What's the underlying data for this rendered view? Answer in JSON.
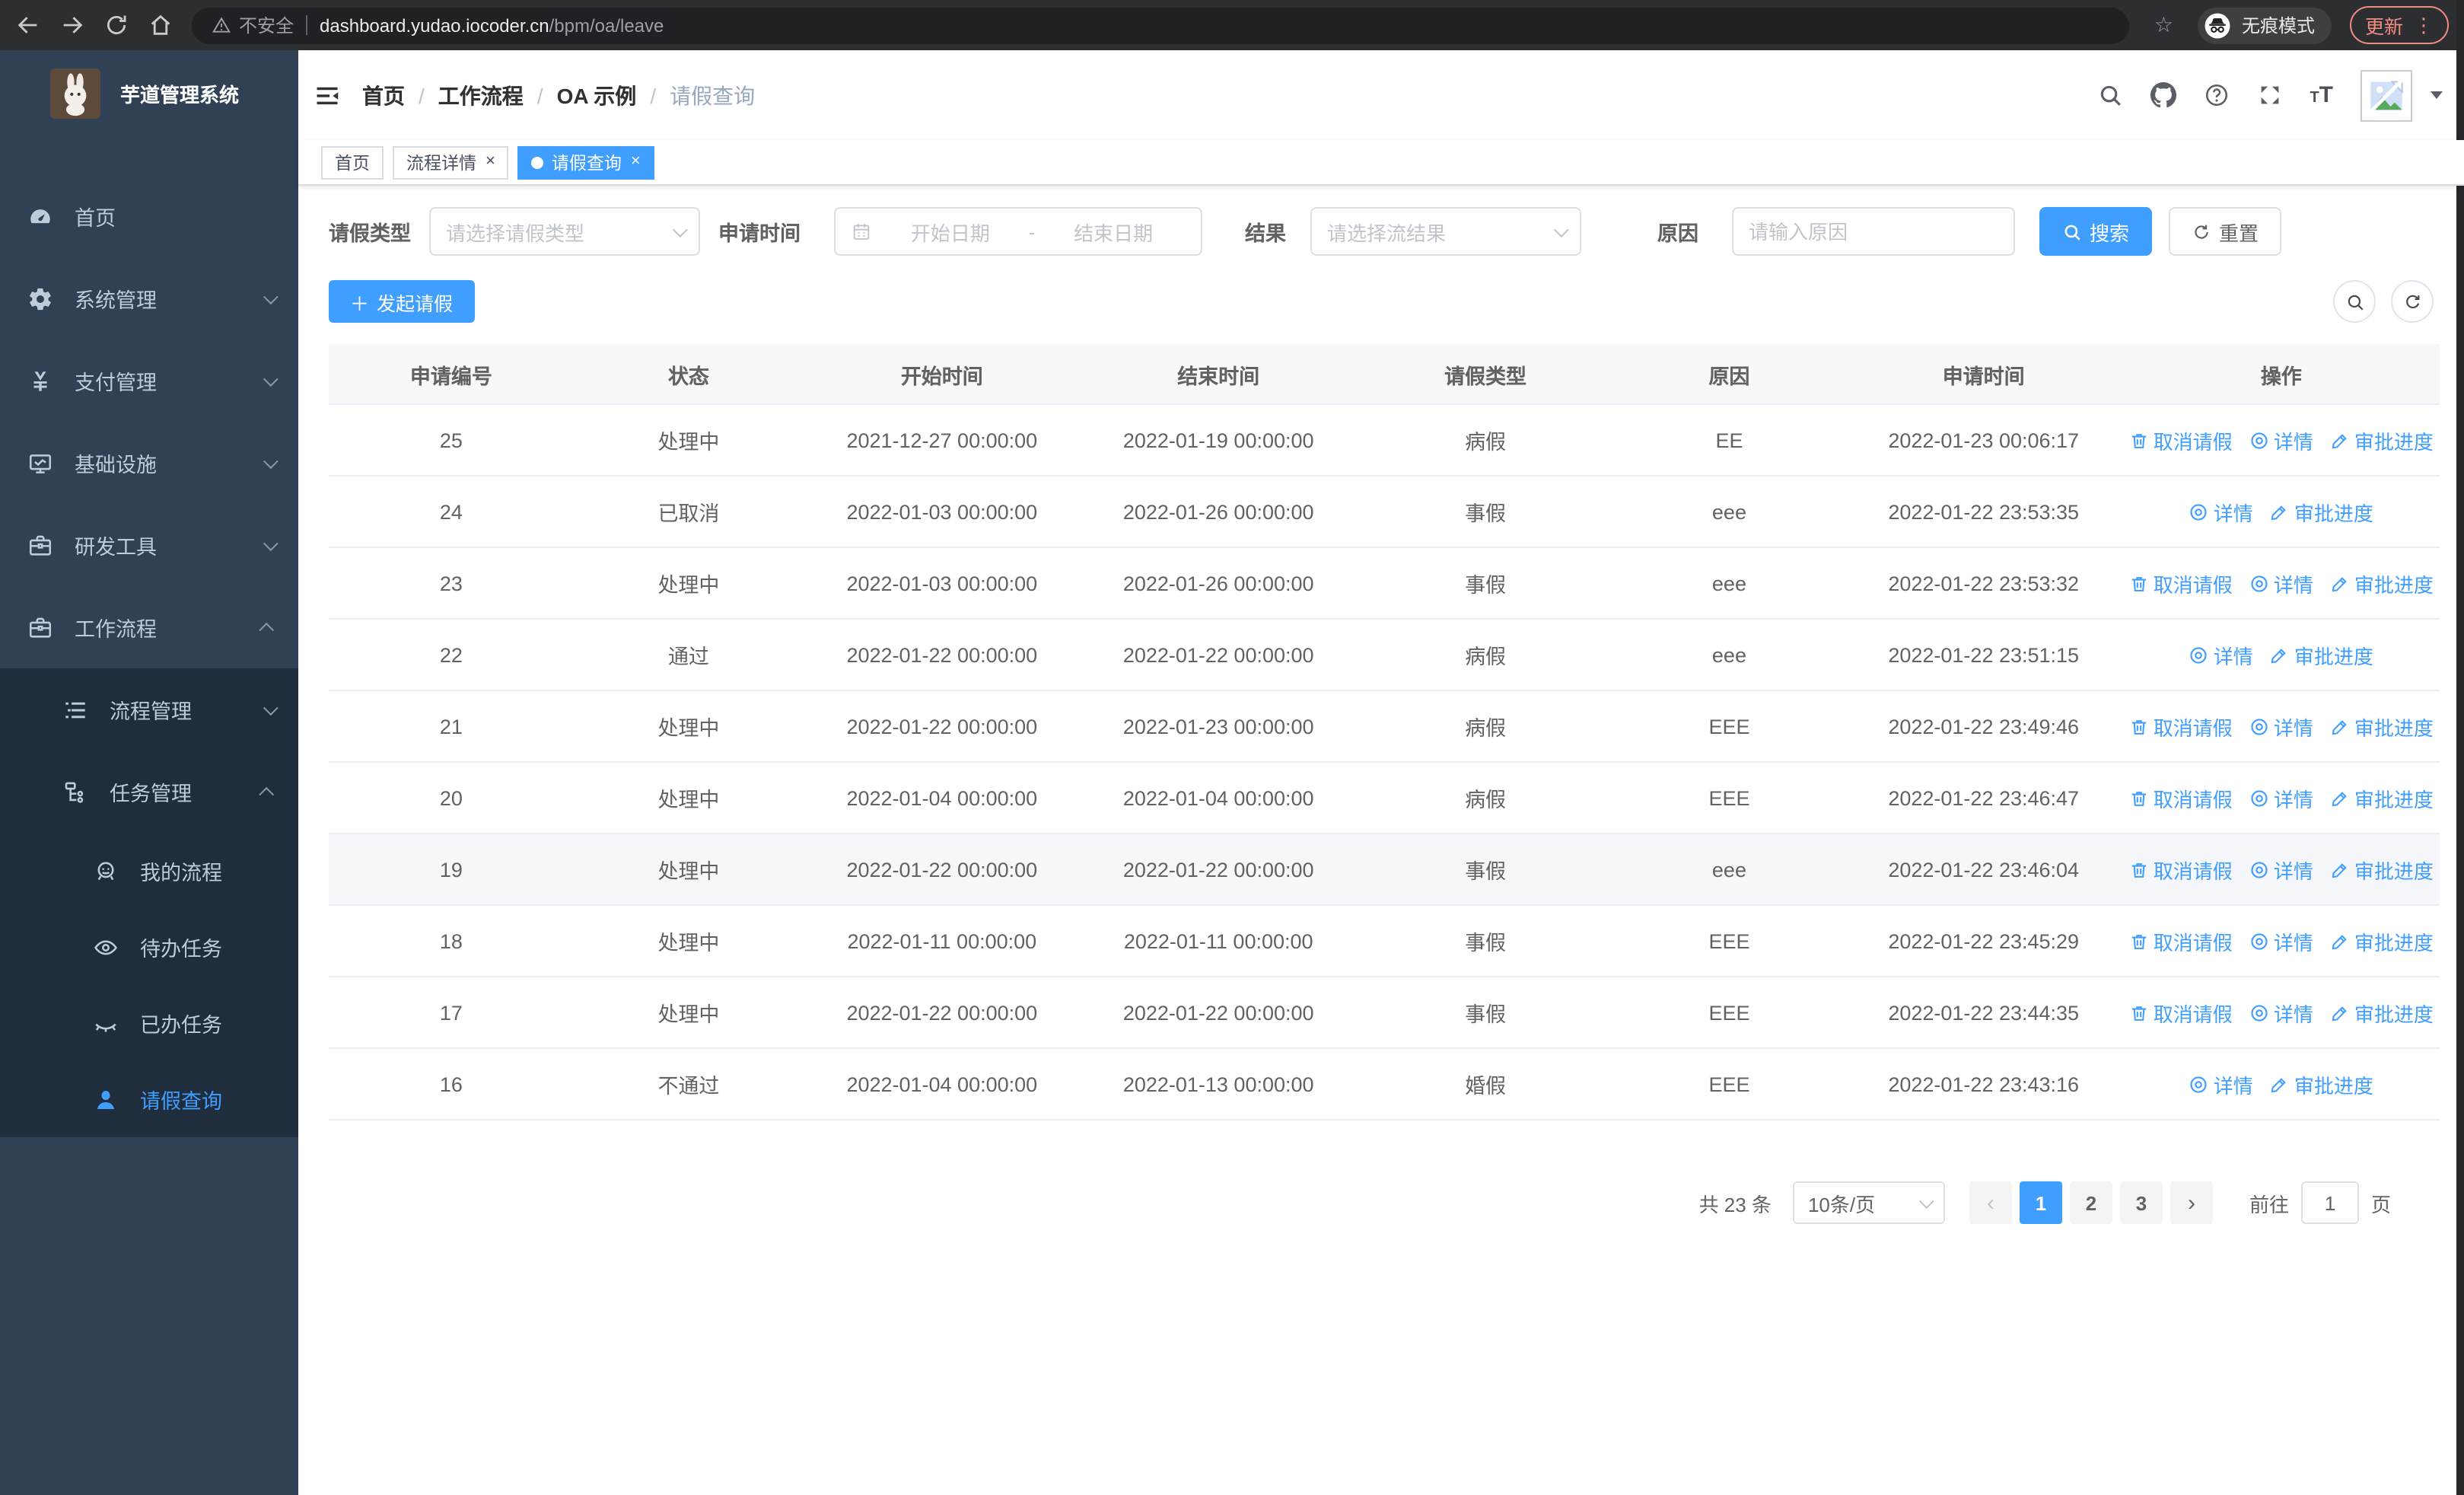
{
  "browser": {
    "security_label": "不安全",
    "url_host": "dashboard.yudao.iocoder.cn",
    "url_path": "/bpm/oa/leave",
    "incognito_label": "无痕模式",
    "update_label": "更新"
  },
  "sidebar": {
    "title": "芋道管理系统",
    "menu": [
      {
        "label": "首页",
        "icon": "dashboard-icon",
        "level": 1,
        "arrow": null,
        "sub": false,
        "active": false
      },
      {
        "label": "系统管理",
        "icon": "gear-icon",
        "level": 1,
        "arrow": "down",
        "sub": false,
        "active": false
      },
      {
        "label": "支付管理",
        "icon": "yen-icon",
        "level": 1,
        "arrow": "down",
        "sub": false,
        "active": false
      },
      {
        "label": "基础设施",
        "icon": "monitor-icon",
        "level": 1,
        "arrow": "down",
        "sub": false,
        "active": false
      },
      {
        "label": "研发工具",
        "icon": "briefcase-icon",
        "level": 1,
        "arrow": "down",
        "sub": false,
        "active": false
      },
      {
        "label": "工作流程",
        "icon": "briefcase-icon",
        "level": 1,
        "arrow": "up",
        "sub": false,
        "active": false
      },
      {
        "label": "流程管理",
        "icon": "list-icon",
        "level": 2,
        "arrow": "down",
        "sub": true,
        "active": false
      },
      {
        "label": "任务管理",
        "icon": "tree-icon",
        "level": 2,
        "arrow": "up",
        "sub": true,
        "active": false
      },
      {
        "label": "我的流程",
        "icon": "robot-icon",
        "level": 3,
        "arrow": null,
        "sub": true,
        "active": false
      },
      {
        "label": "待办任务",
        "icon": "eye-open-icon",
        "level": 3,
        "arrow": null,
        "sub": true,
        "active": false
      },
      {
        "label": "已办任务",
        "icon": "eye-closed-icon",
        "level": 3,
        "arrow": null,
        "sub": true,
        "active": false
      },
      {
        "label": "请假查询",
        "icon": "user-icon",
        "level": 3,
        "arrow": null,
        "sub": true,
        "active": true
      }
    ]
  },
  "breadcrumb": [
    "首页",
    "工作流程",
    "OA 示例",
    "请假查询"
  ],
  "tags": [
    {
      "label": "首页",
      "closable": false,
      "active": false
    },
    {
      "label": "流程详情",
      "closable": true,
      "active": false
    },
    {
      "label": "请假查询",
      "closable": true,
      "active": true
    }
  ],
  "filters": {
    "type_label": "请假类型",
    "type_placeholder": "请选择请假类型",
    "time_label": "申请时间",
    "date_start_placeholder": "开始日期",
    "date_separator": "-",
    "date_end_placeholder": "结束日期",
    "result_label": "结果",
    "result_placeholder": "请选择流结果",
    "reason_label": "原因",
    "reason_placeholder": "请输入原因",
    "search_label": "搜索",
    "reset_label": "重置"
  },
  "toolbar": {
    "create_label": "发起请假"
  },
  "table": {
    "columns": [
      "申请编号",
      "状态",
      "开始时间",
      "结束时间",
      "请假类型",
      "原因",
      "申请时间",
      "操作"
    ],
    "action_labels": {
      "cancel": "取消请假",
      "detail": "详情",
      "progress": "审批进度"
    },
    "rows": [
      {
        "id": "25",
        "status": "处理中",
        "start": "2021-12-27 00:00:00",
        "end": "2022-01-19 00:00:00",
        "type": "病假",
        "reason": "EE",
        "applied": "2022-01-23 00:06:17",
        "cancel": true,
        "hover": false
      },
      {
        "id": "24",
        "status": "已取消",
        "start": "2022-01-03 00:00:00",
        "end": "2022-01-26 00:00:00",
        "type": "事假",
        "reason": "eee",
        "applied": "2022-01-22 23:53:35",
        "cancel": false,
        "hover": false
      },
      {
        "id": "23",
        "status": "处理中",
        "start": "2022-01-03 00:00:00",
        "end": "2022-01-26 00:00:00",
        "type": "事假",
        "reason": "eee",
        "applied": "2022-01-22 23:53:32",
        "cancel": true,
        "hover": false
      },
      {
        "id": "22",
        "status": "通过",
        "start": "2022-01-22 00:00:00",
        "end": "2022-01-22 00:00:00",
        "type": "病假",
        "reason": "eee",
        "applied": "2022-01-22 23:51:15",
        "cancel": false,
        "hover": false
      },
      {
        "id": "21",
        "status": "处理中",
        "start": "2022-01-22 00:00:00",
        "end": "2022-01-23 00:00:00",
        "type": "病假",
        "reason": "EEE",
        "applied": "2022-01-22 23:49:46",
        "cancel": true,
        "hover": false
      },
      {
        "id": "20",
        "status": "处理中",
        "start": "2022-01-04 00:00:00",
        "end": "2022-01-04 00:00:00",
        "type": "病假",
        "reason": "EEE",
        "applied": "2022-01-22 23:46:47",
        "cancel": true,
        "hover": false
      },
      {
        "id": "19",
        "status": "处理中",
        "start": "2022-01-22 00:00:00",
        "end": "2022-01-22 00:00:00",
        "type": "事假",
        "reason": "eee",
        "applied": "2022-01-22 23:46:04",
        "cancel": true,
        "hover": true
      },
      {
        "id": "18",
        "status": "处理中",
        "start": "2022-01-11 00:00:00",
        "end": "2022-01-11 00:00:00",
        "type": "事假",
        "reason": "EEE",
        "applied": "2022-01-22 23:45:29",
        "cancel": true,
        "hover": false
      },
      {
        "id": "17",
        "status": "处理中",
        "start": "2022-01-22 00:00:00",
        "end": "2022-01-22 00:00:00",
        "type": "事假",
        "reason": "EEE",
        "applied": "2022-01-22 23:44:35",
        "cancel": true,
        "hover": false
      },
      {
        "id": "16",
        "status": "不通过",
        "start": "2022-01-04 00:00:00",
        "end": "2022-01-13 00:00:00",
        "type": "婚假",
        "reason": "EEE",
        "applied": "2022-01-22 23:43:16",
        "cancel": false,
        "hover": false
      }
    ]
  },
  "pagination": {
    "total": "共 23 条",
    "page_size": "10条/页",
    "prev": "‹",
    "next": "›",
    "pages": [
      "1",
      "2",
      "3"
    ],
    "active_page": "1",
    "jump_prefix": "前往",
    "jump_value": "1",
    "jump_suffix": "页"
  },
  "colors": {
    "accent": "#409eff",
    "sidebar_bg": "#304156",
    "submenu_bg": "#1f2d3d",
    "update_accent": "#f28b82"
  }
}
